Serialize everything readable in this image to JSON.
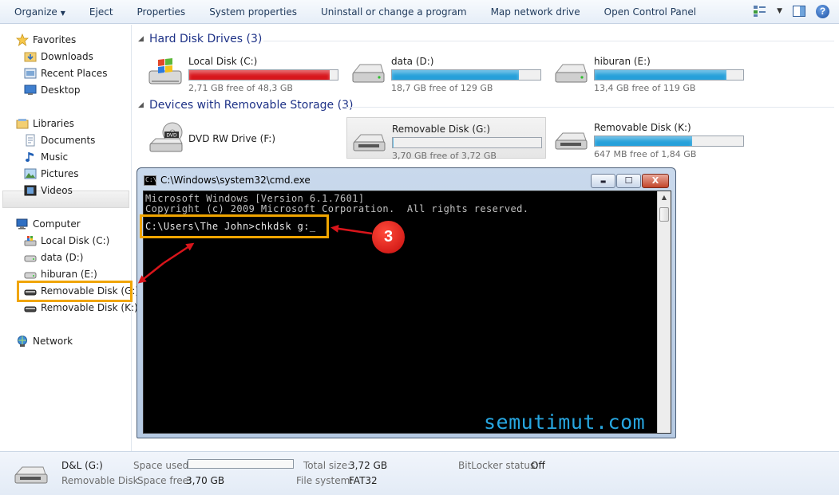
{
  "toolbar": {
    "organize": "Organize",
    "eject": "Eject",
    "properties": "Properties",
    "system_properties": "System properties",
    "uninstall": "Uninstall or change a program",
    "map_network": "Map network drive",
    "control_panel": "Open Control Panel",
    "help": "?"
  },
  "nav": {
    "favorites": "Favorites",
    "downloads": "Downloads",
    "recent_places": "Recent Places",
    "desktop": "Desktop",
    "libraries": "Libraries",
    "documents": "Documents",
    "music": "Music",
    "pictures": "Pictures",
    "videos": "Videos",
    "computer": "Computer",
    "local_disk_c": "Local Disk (C:)",
    "data_d": "data (D:)",
    "hiburan_e": "hiburan (E:)",
    "removable_g": "Removable Disk (G:)",
    "removable_k": "Removable Disk (K:)",
    "network": "Network"
  },
  "sections": {
    "hard_disks": "Hard Disk Drives (3)",
    "removable": "Devices with Removable Storage (3)"
  },
  "drives": {
    "c": {
      "name": "Local Disk (C:)",
      "free": "2,71 GB free of 48,3 GB",
      "used_fraction": 0.944,
      "bar_color": "#d8161c"
    },
    "d": {
      "name": "data (D:)",
      "free": "18,7 GB free of 129 GB",
      "used_fraction": 0.855,
      "bar_color": "#26a0da"
    },
    "e": {
      "name": "hiburan (E:)",
      "free": "13,4 GB free of 119 GB",
      "used_fraction": 0.887,
      "bar_color": "#26a0da"
    },
    "f": {
      "name": "DVD RW Drive (F:)"
    },
    "g": {
      "name": "Removable Disk (G:)",
      "free": "3,70 GB free of 3,72 GB",
      "used_fraction": 0.005,
      "bar_color": "#26a0da"
    },
    "k": {
      "name": "Removable Disk (K:)",
      "free": "647 MB free of 1,84 GB",
      "used_fraction": 0.657,
      "bar_color": "#26a0da"
    }
  },
  "cmd": {
    "title": "C:\\Windows\\system32\\cmd.exe",
    "line1": "Microsoft Windows [Version 6.1.7601]",
    "line2": "Copyright (c) 2009 Microsoft Corporation.  All rights reserved.",
    "prompt": "C:\\Users\\The John>chkdsk g:_",
    "icon_text": "C:\\",
    "minimize": "▬",
    "maximize": "☐",
    "close": "X"
  },
  "annotation": {
    "step": "3",
    "watermark": "semutimut.com"
  },
  "details": {
    "drive_name": "D&L (G:)",
    "drive_type": "Removable Disk",
    "space_used_label": "Space used:",
    "space_free_label": "Space free:",
    "space_free": "3,70 GB",
    "total_size_label": "Total size:",
    "total_size": "3,72 GB",
    "file_system_label": "File system:",
    "file_system": "FAT32",
    "bitlocker_label": "BitLocker status:",
    "bitlocker": "Off"
  }
}
